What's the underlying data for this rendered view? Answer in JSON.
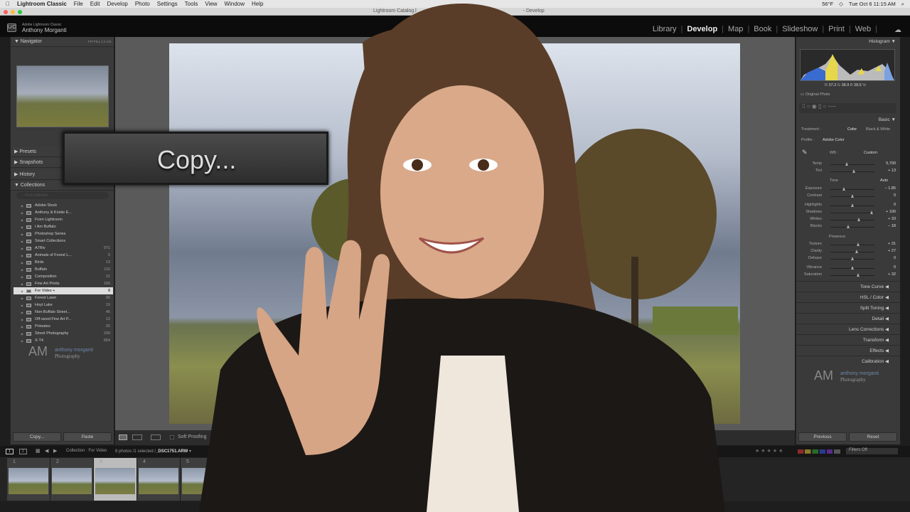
{
  "menubar": {
    "app": "Lightroom Classic",
    "items": [
      "File",
      "Edit",
      "Develop",
      "Photo",
      "Settings",
      "Tools",
      "View",
      "Window",
      "Help"
    ],
    "status": {
      "weather": "56°F",
      "datetime": "Tue Oct 6  11:15 AM"
    }
  },
  "window": {
    "title_left": "Lightroom Catalog.l",
    "title_right": "- Develop"
  },
  "identity": {
    "logo": "LrC",
    "product": "Adobe Lightroom Classic",
    "user": "Anthony Morganti"
  },
  "modules": [
    {
      "label": "Library"
    },
    {
      "label": "Develop",
      "active": true
    },
    {
      "label": "Map"
    },
    {
      "label": "Book"
    },
    {
      "label": "Slideshow"
    },
    {
      "label": "Print"
    },
    {
      "label": "Web"
    }
  ],
  "left": {
    "navigator": {
      "title": "Navigator",
      "zoom": [
        "FIT",
        "FILL",
        "1:1",
        "1:8"
      ]
    },
    "sections": [
      "Presets",
      "Snapshots",
      "History",
      "Collections"
    ],
    "filter_placeholder": "Find Collection",
    "collections": [
      {
        "name": "Adobe Stock",
        "count": ""
      },
      {
        "name": "Anthony & Kristie E...",
        "count": ""
      },
      {
        "name": "From Lightroom",
        "count": ""
      },
      {
        "name": "I Am Buffalo",
        "count": ""
      },
      {
        "name": "Photoshop Series",
        "count": ""
      },
      {
        "name": "Smart Collections",
        "count": ""
      },
      {
        "name": "A7Riv",
        "count": "971"
      },
      {
        "name": "Animals of Forest L...",
        "count": "5"
      },
      {
        "name": "Birds",
        "count": "13"
      },
      {
        "name": "Buffalo",
        "count": "110"
      },
      {
        "name": "Composition",
        "count": "21"
      },
      {
        "name": "Fine Art Prints",
        "count": "166"
      },
      {
        "name": "For Video +",
        "count": "8",
        "selected": true
      },
      {
        "name": "Forest Lawn",
        "count": "95"
      },
      {
        "name": "Hoyt Lake",
        "count": "19"
      },
      {
        "name": "Non-Buffalo Street...",
        "count": "46"
      },
      {
        "name": "Off-sized Fine Art P...",
        "count": "12"
      },
      {
        "name": "Primates",
        "count": "25"
      },
      {
        "name": "Street Photography",
        "count": "209"
      },
      {
        "name": "X-T4",
        "count": "854"
      }
    ],
    "watermark": {
      "mark": "AM",
      "line1": "anthony morganti",
      "line2": "Photography"
    },
    "copy_button": "Copy...",
    "paste_button": "Paste"
  },
  "overlay": {
    "text": "Copy..."
  },
  "toolbar": {
    "soft_proofing": "Soft Proofing"
  },
  "right": {
    "histogram": {
      "title": "Histogram",
      "r": "37.3",
      "g": "38.9",
      "b": "38.5",
      "pct": "%",
      "r_label": "R",
      "g_label": "G",
      "b_label": "B",
      "original": "Original Photo"
    },
    "basic": {
      "title": "Basic",
      "treatment_label": "Treatment :",
      "color": "Color",
      "bw": "Black & White",
      "profile_label": "Profile :",
      "profile": "Adobe Color",
      "wb_label": "WB :",
      "wb": "Custom",
      "tone": "Tone",
      "auto": "Auto",
      "presence": "Presence",
      "sliders": [
        {
          "label": "Temp",
          "value": "5,700",
          "level": 0.38
        },
        {
          "label": "Tint",
          "value": "+ 13",
          "level": 0.54
        },
        {
          "label": "Exposure",
          "value": "– 1.85",
          "level": 0.32
        },
        {
          "label": "Contrast",
          "value": "0",
          "level": 0.5
        },
        {
          "label": "Highlights",
          "value": "0",
          "level": 0.5
        },
        {
          "label": "Shadows",
          "value": "+ 100",
          "level": 0.95
        },
        {
          "label": "Whites",
          "value": "+ 33",
          "level": 0.66
        },
        {
          "label": "Blacks",
          "value": "– 18",
          "level": 0.41
        },
        {
          "label": "Texture",
          "value": "+ 31",
          "level": 0.63
        },
        {
          "label": "Clarity",
          "value": "+ 27",
          "level": 0.61
        },
        {
          "label": "Dehaze",
          "value": "0",
          "level": 0.5
        },
        {
          "label": "Vibrance",
          "value": "0",
          "level": 0.5
        },
        {
          "label": "Saturation",
          "value": "+ 32",
          "level": 0.63
        }
      ]
    },
    "sections": [
      "Tone Curve",
      "HSL / Color",
      "Split Toning",
      "Detail",
      "Lens Corrections",
      "Transform",
      "Effects",
      "Calibration"
    ],
    "watermark": {
      "mark": "AM",
      "line1": "anthony morganti",
      "line2": "Photography"
    },
    "previous_button": "Previous",
    "reset_button": "Reset"
  },
  "filmstrip": {
    "pages": [
      "1",
      "2"
    ],
    "collection": "Collection : For Video",
    "info": "8 photos /1 selected /",
    "file": "_DSC1751.ARW",
    "filter": "Filters Off",
    "frames": [
      "1",
      "2",
      "3",
      "4",
      "5"
    ],
    "selected": "3"
  }
}
